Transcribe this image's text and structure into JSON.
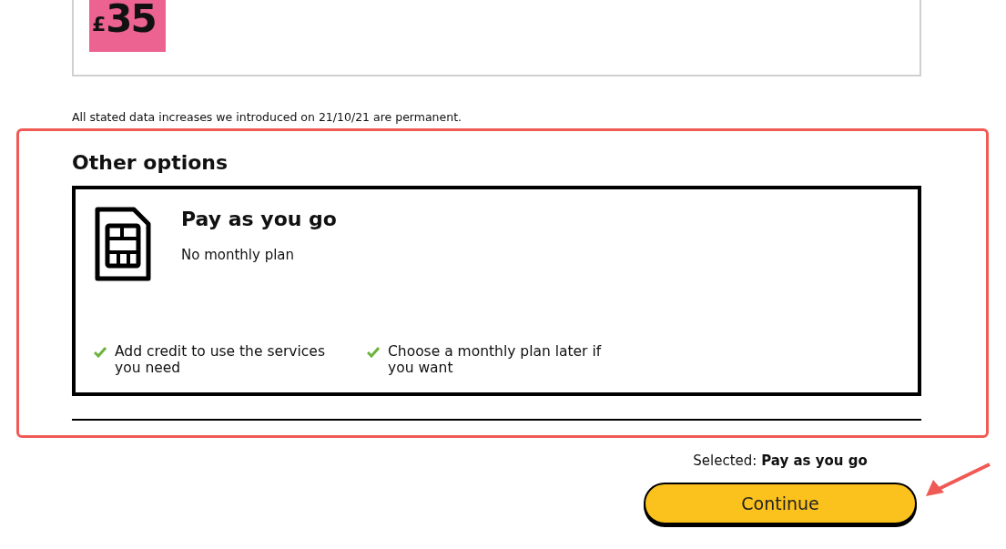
{
  "plan_card": {
    "price": {
      "currency": "£",
      "amount": "35"
    }
  },
  "note": "All stated data increases we introduced on 21/10/21 are permanent.",
  "other_options": {
    "heading": "Other options",
    "options": [
      {
        "title": "Pay as you go",
        "subtitle": "No monthly plan",
        "selected": true,
        "features": [
          "Add credit to use the services you need",
          "Choose a monthly plan later if you want"
        ]
      }
    ]
  },
  "summary": "Selected: **Pay as you go**",
  "continue_button": "Continue"
}
